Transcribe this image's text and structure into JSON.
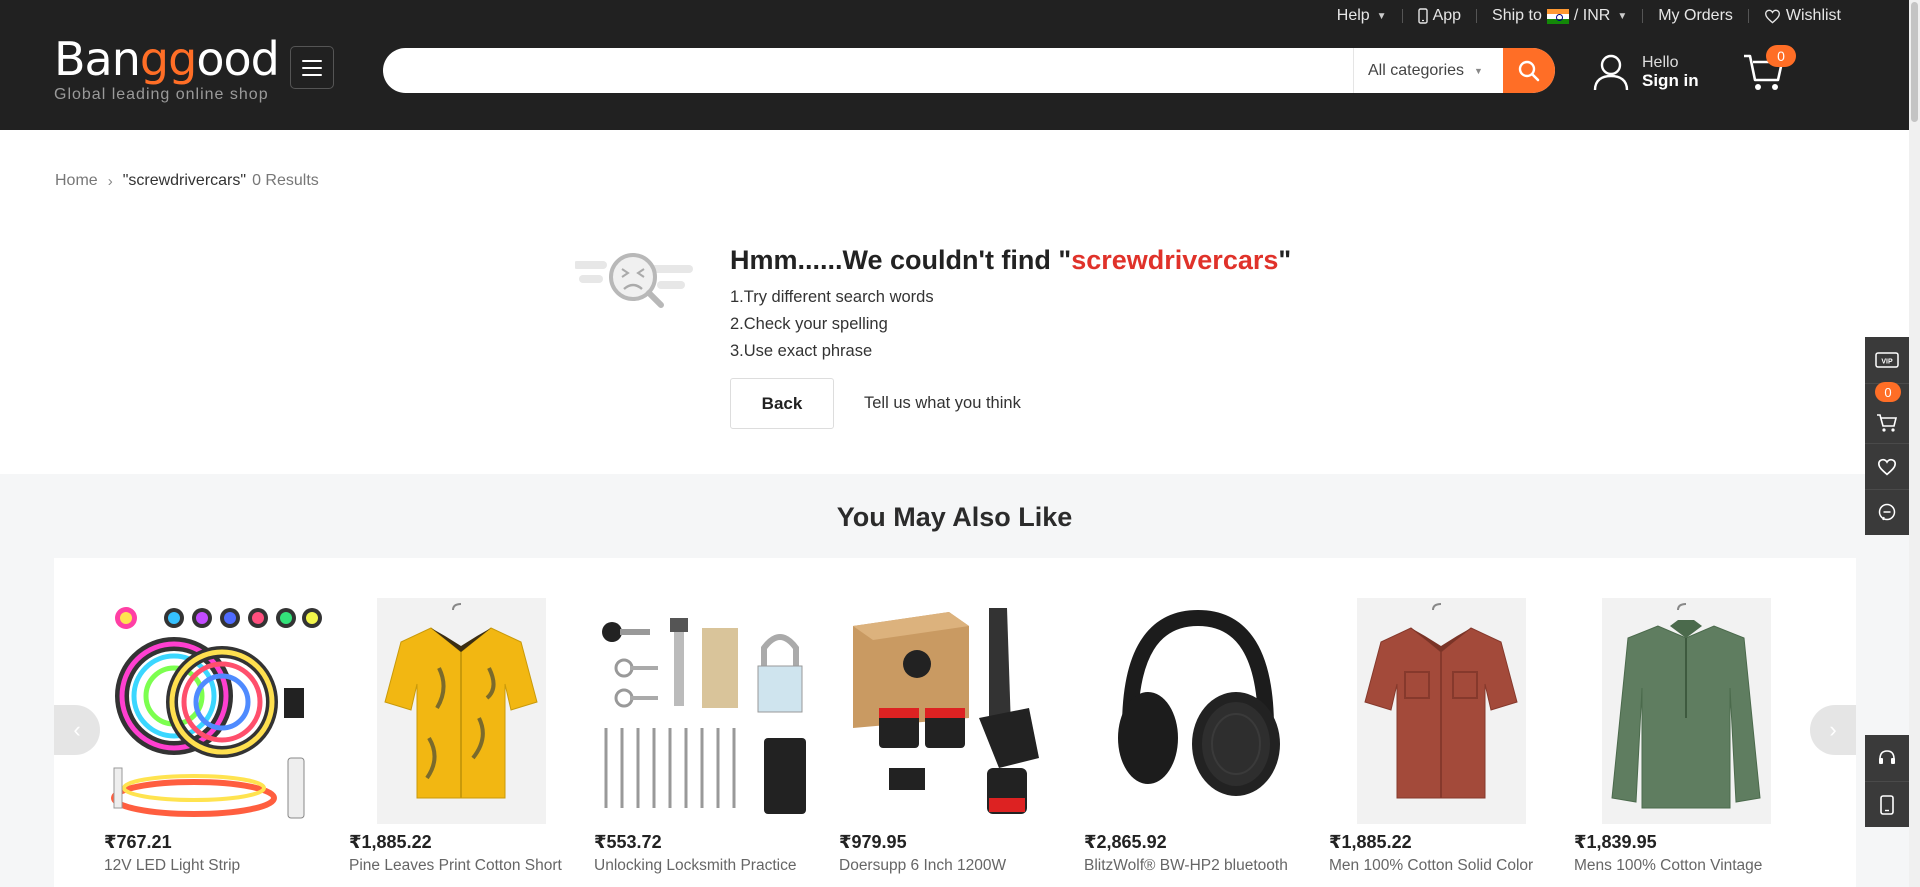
{
  "topbar": {
    "help": "Help",
    "app": "App",
    "ship_to": "Ship to",
    "currency": "/ INR",
    "my_orders": "My Orders",
    "wishlist": "Wishlist"
  },
  "logo": {
    "brand_start": "Ban",
    "brand_gg": "gg",
    "brand_end": "ood",
    "tagline": "Global leading online shop"
  },
  "search": {
    "placeholder": "",
    "category": "All categories"
  },
  "account": {
    "hello": "Hello",
    "sign_in": "Sign in"
  },
  "cart": {
    "count": "0"
  },
  "breadcrumb": {
    "home": "Home",
    "query": "\"screwdrivercars\"",
    "results": "0 Results"
  },
  "not_found": {
    "title_prefix": "Hmm......We couldn't find \"",
    "keyword": "screwdrivercars",
    "title_suffix": "\"",
    "tips": [
      "1.Try different search words",
      "2.Check your spelling",
      "3.Use exact phrase"
    ],
    "back": "Back",
    "feedback": "Tell us what you think"
  },
  "recommendations": {
    "title": "You May Also Like",
    "products": [
      {
        "price": "₹767.21",
        "name": "12V LED Light Strip"
      },
      {
        "price": "₹1,885.22",
        "name": "Pine Leaves Print Cotton Short"
      },
      {
        "price": "₹553.72",
        "name": "Unlocking Locksmith Practice"
      },
      {
        "price": "₹979.95",
        "name": "Doersupp 6 Inch 1200W"
      },
      {
        "price": "₹2,865.92",
        "name": "BlitzWolf® BW-HP2 bluetooth"
      },
      {
        "price": "₹1,885.22",
        "name": "Men 100% Cotton Solid Color"
      },
      {
        "price": "₹1,839.95",
        "name": "Mens 100% Cotton Vintage"
      }
    ]
  },
  "sidebar": {
    "vip": "VIP",
    "cart_count": "0"
  },
  "colors": {
    "accent": "#ff6e26",
    "header_bg": "#212121",
    "keyword": "#e0322a"
  }
}
